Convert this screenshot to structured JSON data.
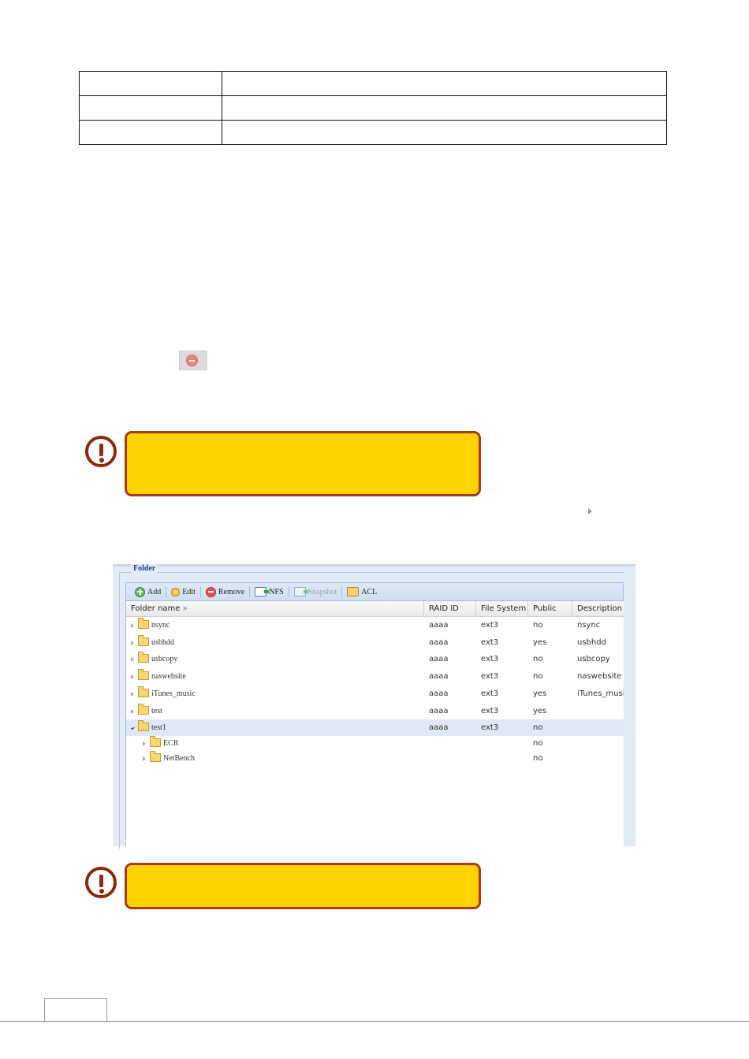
{
  "panel": {
    "legend": "Folder",
    "toolbar": {
      "add": "Add",
      "edit": "Edit",
      "remove": "Remove",
      "nfs": "NFS",
      "snapshot": "Snapshot",
      "acl": "ACL"
    },
    "columns": {
      "name": "Folder name",
      "raid": "RAID ID",
      "fs": "File System",
      "public": "Public",
      "desc": "Description"
    },
    "rows": [
      {
        "name": "nsync",
        "raid": "aaaa",
        "fs": "ext3",
        "public": "no",
        "desc": "nsync"
      },
      {
        "name": "usbhdd",
        "raid": "aaaa",
        "fs": "ext3",
        "public": "yes",
        "desc": "usbhdd"
      },
      {
        "name": "usbcopy",
        "raid": "aaaa",
        "fs": "ext3",
        "public": "no",
        "desc": "usbcopy"
      },
      {
        "name": "naswebsite",
        "raid": "aaaa",
        "fs": "ext3",
        "public": "no",
        "desc": "naswebsite"
      },
      {
        "name": "iTunes_music",
        "raid": "aaaa",
        "fs": "ext3",
        "public": "yes",
        "desc": "iTunes_music"
      },
      {
        "name": "test",
        "raid": "aaaa",
        "fs": "ext3",
        "public": "yes",
        "desc": ""
      },
      {
        "name": "test1",
        "raid": "aaaa",
        "fs": "ext3",
        "public": "no",
        "desc": ""
      },
      {
        "name": "ECR",
        "raid": "",
        "fs": "",
        "public": "no",
        "desc": ""
      },
      {
        "name": "NetBench",
        "raid": "",
        "fs": "",
        "public": "no",
        "desc": ""
      }
    ]
  },
  "colors": {
    "warning_fill": "#fed100",
    "warning_border": "#a93c17",
    "warning_icon": "#8b2a0c",
    "selected_row": "#dfe8f6"
  }
}
